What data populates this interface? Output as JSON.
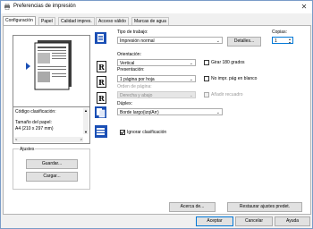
{
  "window": {
    "title": "Preferencias de impresión",
    "close_icon": "close-icon"
  },
  "tabs": [
    {
      "label": "Configuración"
    },
    {
      "label": "Papel"
    },
    {
      "label": "Calidad impres."
    },
    {
      "label": "Acceso válido"
    },
    {
      "label": "Marcas de agua"
    }
  ],
  "left": {
    "list": {
      "line1": "Código clasificación:",
      "line2": "Tamaño del papel:",
      "line3": "A4 (210 x 297 mm)"
    },
    "settings_group": "Ajustes",
    "save_button": "Guardar...",
    "load_button": "Cargar..."
  },
  "job": {
    "label": "Tipo de trabajo:",
    "value": "Impresión normal",
    "details_button": "Detalles..."
  },
  "copies": {
    "label": "Copias:",
    "value": "1"
  },
  "orientation": {
    "label": "Orientación:",
    "value": "Vertical",
    "rotate_label": "Girar 180 grados"
  },
  "presentation": {
    "label": "Presentación:",
    "value": "1 página por hoja",
    "blank_label": "No impr. pág en blanco"
  },
  "page_order": {
    "label": "Orden de página:",
    "value": "Derecha y abajo",
    "border_label": "Añadir recuadro"
  },
  "duplex": {
    "label": "Dúplex:",
    "value": "Borde largo(izq/Arr)"
  },
  "collate": {
    "label": "Ignorar clasificación",
    "checked": true
  },
  "footer": {
    "about_button": "Acerca de...",
    "restore_button": "Restaurar ajustes predet.",
    "ok_button": "Aceptar",
    "cancel_button": "Cancelar",
    "help_button": "Ayuda"
  },
  "colors": {
    "accent": "#0078d7",
    "icon_blue": "#1a4fb5"
  }
}
